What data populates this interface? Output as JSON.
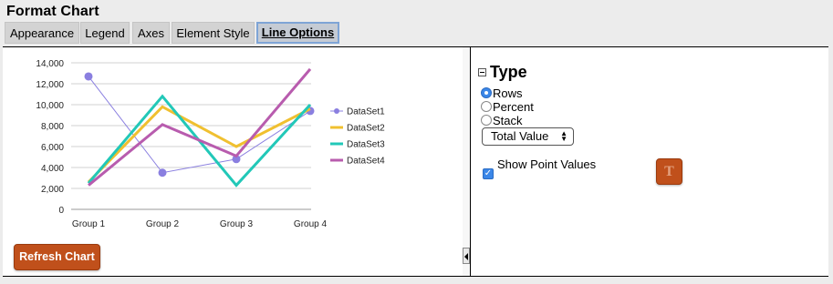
{
  "window": {
    "title": "Format Chart"
  },
  "tabs": [
    {
      "label": "Appearance",
      "active": false
    },
    {
      "label": "Legend",
      "active": false
    },
    {
      "label": "Axes",
      "active": false
    },
    {
      "label": "Element Style",
      "active": false
    },
    {
      "label": "Line Options",
      "active": true
    }
  ],
  "chart_panel": {
    "refresh_label": "Refresh Chart"
  },
  "chart_data": {
    "type": "line",
    "categories": [
      "Group 1",
      "Group 2",
      "Group 3",
      "Group 4"
    ],
    "ylim": [
      0,
      14000
    ],
    "yticks": [
      0,
      2000,
      4000,
      6000,
      8000,
      10000,
      12000,
      14000
    ],
    "ytick_labels": [
      "0",
      "2,000",
      "4,000",
      "6,000",
      "8,000",
      "10,000",
      "12,000",
      "14,000"
    ],
    "grid": true,
    "legend_position": "right",
    "series": [
      {
        "name": "DataSet1",
        "values": [
          12700,
          3500,
          4800,
          9400
        ],
        "color": "#8a7fe0",
        "markers": true
      },
      {
        "name": "DataSet2",
        "values": [
          2600,
          9800,
          6000,
          9600
        ],
        "color": "#f0c030",
        "markers": false
      },
      {
        "name": "DataSet3",
        "values": [
          2500,
          10800,
          2300,
          10000
        ],
        "color": "#22c8b8",
        "markers": false
      },
      {
        "name": "DataSet4",
        "values": [
          2300,
          8100,
          5100,
          13400
        ],
        "color": "#b85cae",
        "markers": false
      }
    ]
  },
  "line_options": {
    "section_title": "Type",
    "radio_options": [
      {
        "label": "Rows",
        "checked": true
      },
      {
        "label": "Percent",
        "checked": false
      },
      {
        "label": "Stack",
        "checked": false
      }
    ],
    "value_select": "Total Value",
    "show_point_values_label": "Show Point Values",
    "show_point_values_checked": true
  }
}
